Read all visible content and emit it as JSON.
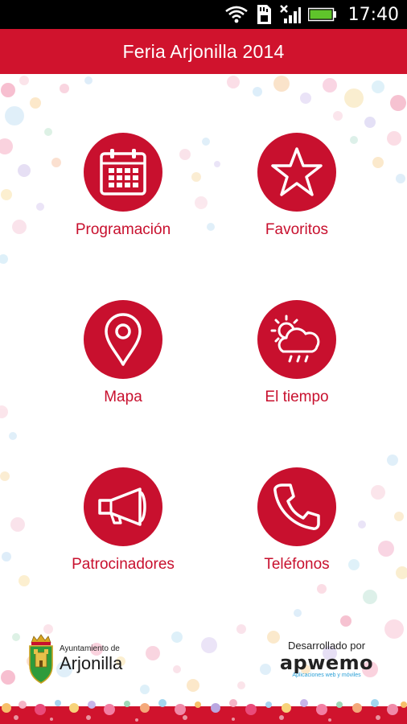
{
  "status_bar": {
    "time": "17:40",
    "icons": [
      "wifi-icon",
      "sd-card-icon",
      "no-signal-icon",
      "battery-icon"
    ]
  },
  "app_bar": {
    "title": "Feria Arjonilla 2014"
  },
  "menu": [
    {
      "label": "Programación",
      "icon": "calendar-icon"
    },
    {
      "label": "Favoritos",
      "icon": "star-icon"
    },
    {
      "label": "Mapa",
      "icon": "map-pin-icon"
    },
    {
      "label": "El tiempo",
      "icon": "weather-icon"
    },
    {
      "label": "Patrocinadores",
      "icon": "megaphone-icon"
    },
    {
      "label": "Teléfonos",
      "icon": "phone-icon"
    }
  ],
  "footer": {
    "ayuntamiento_small": "Ayuntamiento de",
    "ayuntamiento_name": "Arjonilla",
    "developer_label": "Desarrollado por",
    "developer_brand": "apwemo",
    "developer_tagline": "Aplicaciones web y móviles"
  },
  "colors": {
    "primary": "#c8102e",
    "appbar": "#d0132d",
    "statusbar": "#000000",
    "battery": "#5fc42b",
    "brand_tagline": "#2a9fd6"
  }
}
